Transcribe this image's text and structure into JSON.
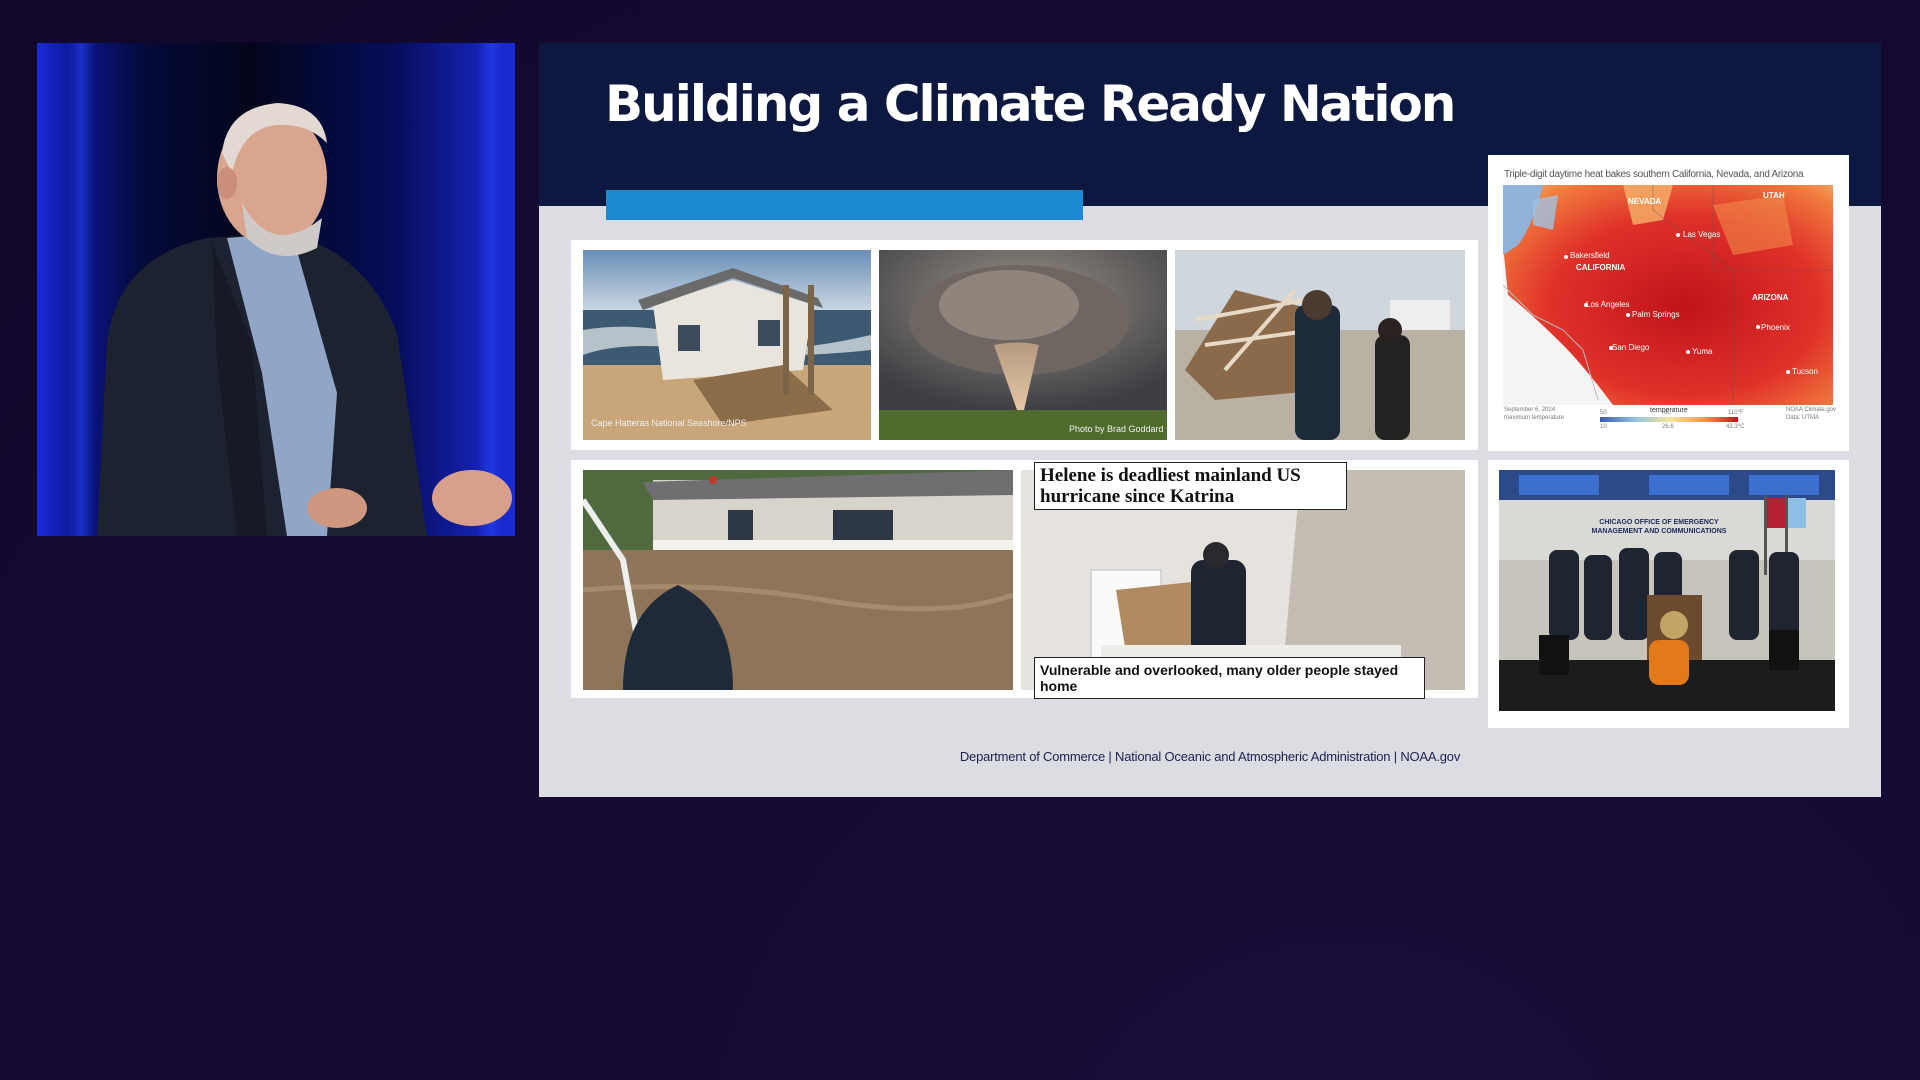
{
  "slide": {
    "title": "Building a Climate Ready Nation",
    "footer": "Department of Commerce | National Oceanic and Atmospheric Administration | NOAA.gov",
    "colors": {
      "header": "#0c1840",
      "accent_bar": "#1b8ad0",
      "background": "#dcdde2"
    }
  },
  "photos": {
    "beach_house_credit": "Cape Hatteras National Seashore/NPS",
    "tornado_credit": "Photo by  Brad Goddard",
    "helene_headline": "Helene is deadliest mainland US hurricane since Katrina",
    "older_people_caption": "Vulnerable and overlooked, many older people stayed home"
  },
  "heat_map": {
    "title": "Triple-digit daytime heat bakes southern California, Nevada, and Arizona",
    "labels": [
      "NEVADA",
      "UTAH",
      "CALIFORNIA",
      "Las Vegas",
      "Bakersfield",
      "Los Angeles",
      "Palm Springs",
      "ARIZONA",
      "Phoenix",
      "San Diego",
      "Yuma",
      "Tucson"
    ],
    "legend_title": "temperature",
    "legend_ticks_f": [
      "50",
      "80",
      "110°F"
    ],
    "legend_ticks_c": [
      "10",
      "26.6",
      "43.3°C"
    ],
    "date_note": "September 6, 2024",
    "date_sub": "maximum temperature",
    "source_note": "NOAA Climate.gov",
    "source_sub": "Data: UTMA"
  },
  "press_conference": {
    "banner": "CHICAGO OFFICE OF EMERGENCY MANAGEMENT AND COMMUNICATIONS"
  }
}
